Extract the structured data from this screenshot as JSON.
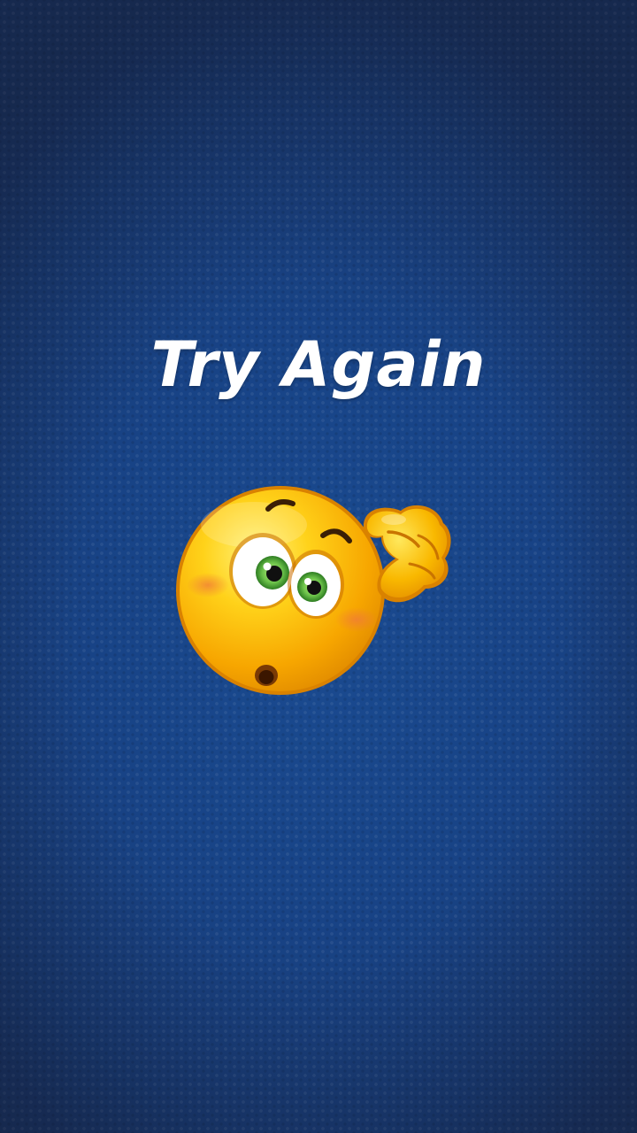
{
  "screen": {
    "background_color": "#184386"
  },
  "result": {
    "title": "Try Again"
  },
  "emoji": {
    "icon": "confused-thinking-emoji-icon",
    "face_color": "#FFC20E",
    "eye_color": "#6CC24A"
  }
}
